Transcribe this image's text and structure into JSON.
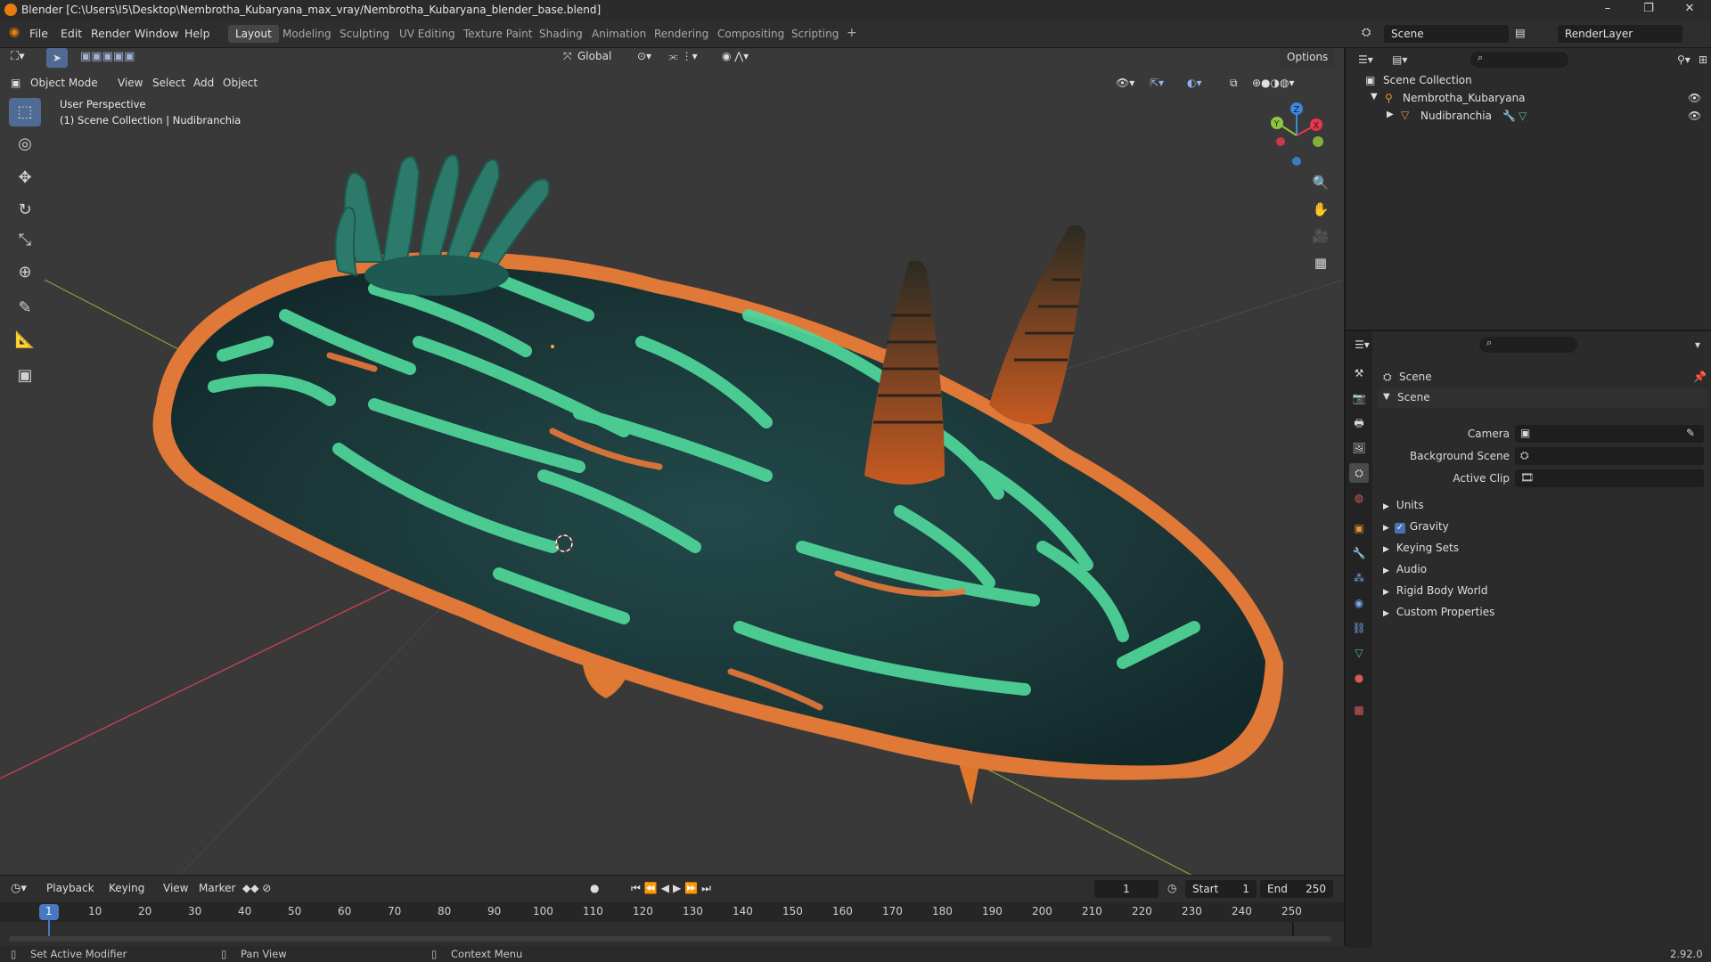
{
  "window": {
    "title": "Blender [C:\\Users\\I5\\Desktop\\Nembrotha_Kubaryana_max_vray/Nembrotha_Kubaryana_blender_base.blend]",
    "minimize": "–",
    "maximize": "❐",
    "close": "✕"
  },
  "menu": {
    "file": "File",
    "edit": "Edit",
    "render": "Render",
    "window": "Window",
    "help": "Help"
  },
  "workspaces": [
    "Layout",
    "Modeling",
    "Sculpting",
    "UV Editing",
    "Texture Paint",
    "Shading",
    "Animation",
    "Rendering",
    "Compositing",
    "Scripting"
  ],
  "workspace_add": "+",
  "scene_selector": {
    "scene": "Scene",
    "view_layer": "RenderLayer"
  },
  "viewport": {
    "transform_orientation": "Global",
    "options": "Options",
    "mode": "Object Mode",
    "menus": [
      "View",
      "Select",
      "Add",
      "Object"
    ],
    "overlay_title": "User Perspective",
    "overlay_subtitle": "(1) Scene Collection | Nudibranchia",
    "gizmo": {
      "x": "X",
      "y": "Y",
      "z": "Z"
    }
  },
  "tools": [
    {
      "name": "select-box-tool",
      "glyph": "⬚"
    },
    {
      "name": "cursor-tool",
      "glyph": "◎"
    },
    {
      "name": "move-tool",
      "glyph": "✥"
    },
    {
      "name": "rotate-tool",
      "glyph": "↻"
    },
    {
      "name": "scale-tool",
      "glyph": "⤡"
    },
    {
      "name": "transform-tool",
      "glyph": "⊕"
    },
    {
      "name": "annotate-tool",
      "glyph": "✎"
    },
    {
      "name": "measure-tool",
      "glyph": "📐"
    },
    {
      "name": "add-cube-tool",
      "glyph": "▣"
    }
  ],
  "nav_icons": [
    {
      "name": "zoom-icon",
      "glyph": "🔍"
    },
    {
      "name": "pan-hand-icon",
      "glyph": "✋"
    },
    {
      "name": "camera-view-icon",
      "glyph": "🎥"
    },
    {
      "name": "ortho-grid-icon",
      "glyph": "▦"
    }
  ],
  "timeline": {
    "menus": [
      "Playback",
      "Keying",
      "View",
      "Marker"
    ],
    "current_frame": "1",
    "start_label": "Start",
    "start": "1",
    "end_label": "End",
    "end": "250",
    "ticks": [
      "1",
      "10",
      "20",
      "30",
      "40",
      "50",
      "60",
      "70",
      "80",
      "90",
      "100",
      "110",
      "120",
      "130",
      "140",
      "150",
      "160",
      "170",
      "180",
      "190",
      "200",
      "210",
      "220",
      "230",
      "240",
      "250"
    ]
  },
  "statusbar": {
    "left": "Set Active Modifier",
    "middle": "Pan View",
    "right": "Context Menu",
    "version": "2.92.0"
  },
  "outliner": {
    "root": "Scene Collection",
    "items": [
      {
        "label": "Nembrotha_Kubaryana"
      },
      {
        "label": "Nudibranchia"
      }
    ]
  },
  "properties": {
    "header": "Scene",
    "panel_title": "Scene",
    "fields": [
      {
        "label": "Camera"
      },
      {
        "label": "Background Scene"
      },
      {
        "label": "Active Clip"
      }
    ],
    "sections": [
      "Units",
      "Gravity",
      "Keying Sets",
      "Audio",
      "Rigid Body World",
      "Custom Properties"
    ],
    "gravity_checked": true
  },
  "colors": {
    "accent": "#4f6a93",
    "frame_indicator": "#4778c2",
    "axis_x": "#e8374c",
    "axis_y": "#8ec63f",
    "axis_z": "#3d87e0",
    "slug_body": "#1f3e3f",
    "slug_stripe": "#4fd79a",
    "slug_edge": "#ee7a34"
  }
}
